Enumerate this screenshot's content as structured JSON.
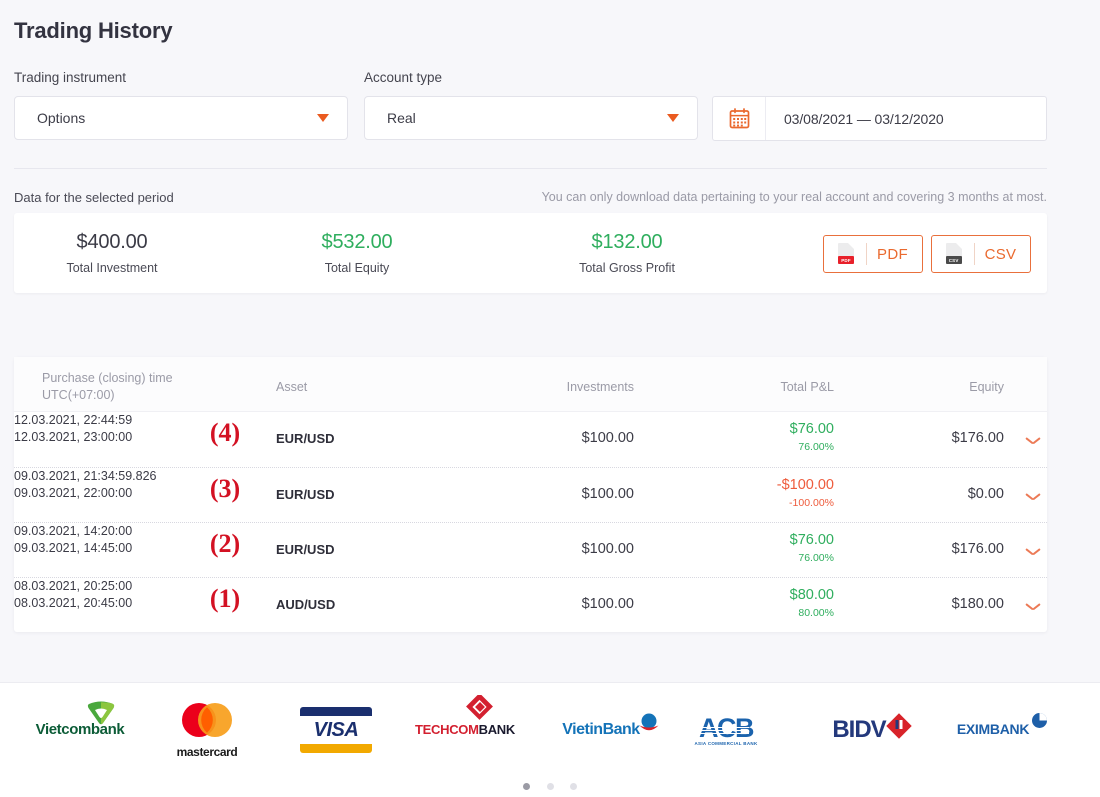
{
  "header": {
    "title": "Trading History"
  },
  "filters": {
    "instrument": {
      "label": "Trading instrument",
      "value": "Options"
    },
    "account": {
      "label": "Account type",
      "value": "Real"
    },
    "daterange": {
      "value": "03/08/2021 — 03/12/2020",
      "icon": "calendar-icon"
    }
  },
  "summary": {
    "caption": "Data for the selected period",
    "note": "You can only download data pertaining to your real account and covering 3 months at most.",
    "stats": [
      {
        "value": "$400.00",
        "label": "Total Investment",
        "color": "#3b3b46"
      },
      {
        "value": "$532.00",
        "label": "Total Equity",
        "color": "#2fae5e"
      },
      {
        "value": "$132.00",
        "label": "Total Gross Profit",
        "color": "#2fae5e"
      }
    ],
    "downloads": [
      {
        "label": "PDF",
        "tag": "PDF",
        "tag_color": "#e8202a"
      },
      {
        "label": "CSV",
        "tag": "CSV",
        "tag_color": "#4a4a4a"
      }
    ]
  },
  "table": {
    "columns": {
      "time_line1": "Purchase (closing) time",
      "time_line2": "UTC(+07:00)",
      "asset": "Asset",
      "investments": "Investments",
      "pl": "Total P&L",
      "equity": "Equity"
    },
    "rows": [
      {
        "time_open": "12.03.2021, 22:44:59",
        "time_close": "12.03.2021, 23:00:00",
        "annotation": "(4)",
        "asset": "EUR/USD",
        "investment": "$100.00",
        "pl_amount": "$76.00",
        "pl_percent": "76.00%",
        "pl_color": "#2fae5e",
        "equity": "$176.00"
      },
      {
        "time_open": "09.03.2021, 21:34:59.826",
        "time_close": "09.03.2021, 22:00:00",
        "annotation": "(3)",
        "asset": "EUR/USD",
        "investment": "$100.00",
        "pl_amount": "-$100.00",
        "pl_percent": "-100.00%",
        "pl_color": "#ee5b3c",
        "equity": "$0.00"
      },
      {
        "time_open": "09.03.2021, 14:20:00",
        "time_close": "09.03.2021, 14:45:00",
        "annotation": "(2)",
        "asset": "EUR/USD",
        "investment": "$100.00",
        "pl_amount": "$76.00",
        "pl_percent": "76.00%",
        "pl_color": "#2fae5e",
        "equity": "$176.00"
      },
      {
        "time_open": "08.03.2021, 20:25:00",
        "time_close": "08.03.2021, 20:45:00",
        "annotation": "(1)",
        "asset": "AUD/USD",
        "investment": "$100.00",
        "pl_amount": "$80.00",
        "pl_percent": "80.00%",
        "pl_color": "#2fae5e",
        "equity": "$180.00"
      }
    ]
  },
  "footer": {
    "logos": [
      {
        "name": "Vietcombank"
      },
      {
        "name": "mastercard"
      },
      {
        "name": "VISA"
      },
      {
        "name": "TECHCOMBANK",
        "part1": "TECHCOM",
        "part2": "BANK"
      },
      {
        "name": "VietinBank"
      },
      {
        "name": "ACB",
        "sub": "ASIA COMMERCIAL BANK"
      },
      {
        "name": "BIDV"
      },
      {
        "name": "EXIMBANK"
      }
    ],
    "carousel": {
      "total_dots": 3,
      "active_index": 0
    }
  },
  "theme": {
    "accent": "#ea5b20",
    "green": "#2fae5e",
    "red": "#ee5b3c",
    "annotation_red": "#d31123",
    "background": "#f7f7fa"
  }
}
